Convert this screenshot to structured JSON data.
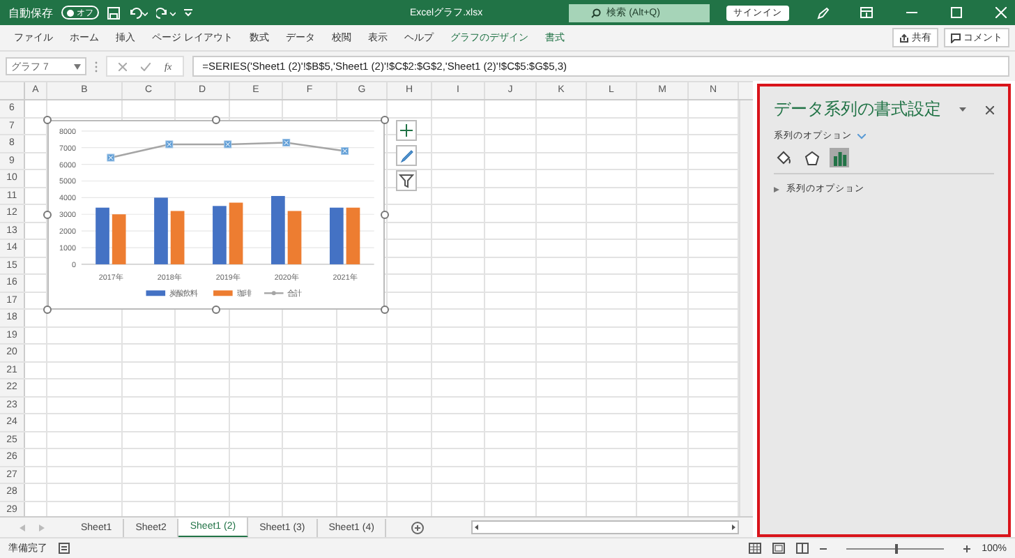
{
  "title_bar": {
    "autosave_label": "自動保存",
    "autosave": {
      "on": false,
      "label": "オフ"
    },
    "file_name": "Excelグラフ.xlsx",
    "search_placeholder": "検索 (Alt+Q)",
    "signin": "サインイン"
  },
  "ribbon": {
    "tabs": [
      {
        "label": "ファイル",
        "contextual": false
      },
      {
        "label": "ホーム",
        "contextual": false
      },
      {
        "label": "挿入",
        "contextual": false
      },
      {
        "label": "ページ レイアウト",
        "contextual": false
      },
      {
        "label": "数式",
        "contextual": false
      },
      {
        "label": "データ",
        "contextual": false
      },
      {
        "label": "校閲",
        "contextual": false
      },
      {
        "label": "表示",
        "contextual": false
      },
      {
        "label": "ヘルプ",
        "contextual": false
      },
      {
        "label": "グラフのデザイン",
        "contextual": true
      },
      {
        "label": "書式",
        "contextual": true
      }
    ],
    "share": "共有",
    "comments": "コメント"
  },
  "formula_bar": {
    "name_box": "グラフ 7",
    "fx": "fx",
    "formula": "=SERIES('Sheet1 (2)'!$B$5,'Sheet1 (2)'!$C$2:$G$2,'Sheet1 (2)'!$C$5:$G$5,3)"
  },
  "sheet": {
    "columns": [
      "A",
      "B",
      "C",
      "D",
      "E",
      "F",
      "G",
      "H",
      "I",
      "J",
      "K",
      "L",
      "M",
      "N"
    ],
    "rows": [
      "6",
      "7",
      "8",
      "9",
      "10",
      "11",
      "12",
      "13",
      "14",
      "15",
      "16",
      "17",
      "18",
      "19",
      "20",
      "21",
      "22",
      "23",
      "24",
      "25",
      "26",
      "27",
      "28",
      "29"
    ],
    "chart": {
      "chart_data": {
        "type": "bar",
        "categories": [
          "2017年",
          "2018年",
          "2019年",
          "2020年",
          "2021年"
        ],
        "series": [
          {
            "name": "炭酸飲料",
            "color": "#4472c4",
            "type": "bar",
            "values": [
              3400,
              4000,
              3500,
              4100,
              3400
            ]
          },
          {
            "name": "珈琲",
            "color": "#ed7d31",
            "type": "bar",
            "values": [
              3000,
              3200,
              3700,
              3200,
              3400
            ]
          },
          {
            "name": "合計",
            "color": "#a5a5a5",
            "type": "line",
            "marker": "square",
            "values": [
              6400,
              7200,
              7200,
              7300,
              6800
            ]
          }
        ],
        "stacked": false,
        "grid": true,
        "legend": "bottom",
        "ylim": [
          0,
          8000
        ],
        "yticks": [
          0,
          1000,
          2000,
          3000,
          4000,
          5000,
          6000,
          7000,
          8000
        ]
      }
    }
  },
  "format_pane": {
    "title": "データ系列の書式設定",
    "options_dropdown": "系列のオプション",
    "tabs": [
      {
        "kind": "fill",
        "selected": false
      },
      {
        "kind": "effects",
        "selected": false
      },
      {
        "kind": "series",
        "selected": true
      }
    ],
    "sections": [
      {
        "label": "系列のオプション",
        "expanded": false
      }
    ]
  },
  "sheet_tabs": [
    {
      "label": "Sheet1",
      "selected": false
    },
    {
      "label": "Sheet2",
      "selected": false
    },
    {
      "label": "Sheet1 (2)",
      "selected": true
    },
    {
      "label": "Sheet1 (3)",
      "selected": false
    },
    {
      "label": "Sheet1 (4)",
      "selected": false
    }
  ],
  "status_bar": {
    "status": "準備完了",
    "zoom_slider": {
      "level": 0.5
    },
    "zoom": "100%"
  }
}
